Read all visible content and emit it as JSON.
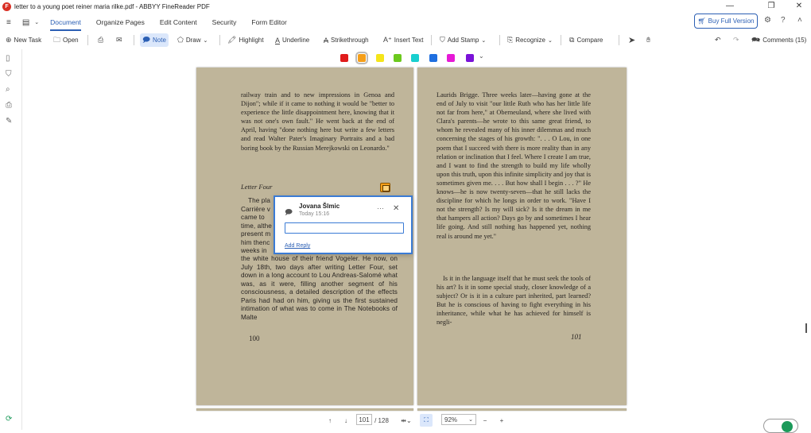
{
  "window": {
    "title": "letter to a young poet reiner maria rilke.pdf - ABBYY FineReader PDF"
  },
  "menu": {
    "tabs": [
      "Document",
      "Organize Pages",
      "Edit Content",
      "Security",
      "Form Editor"
    ],
    "buy_full_version": "Buy Full Version"
  },
  "toolbar": {
    "new_task": "New Task",
    "open": "Open",
    "note": "Note",
    "draw": "Draw",
    "highlight": "Highlight",
    "underline": "Underline",
    "strikethrough": "Strikethrough",
    "insert_text": "Insert Text",
    "add_stamp": "Add Stamp",
    "recognize": "Recognize",
    "compare": "Compare",
    "comments": "Comments (15)"
  },
  "colors": {
    "swatches": [
      "#e01b1b",
      "#f59f1a",
      "#f5e51a",
      "#6cc91e",
      "#19cfcf",
      "#1f6fe0",
      "#e619d6",
      "#7a12d8"
    ],
    "selected_index": 1,
    "accent": "#2b5fb4"
  },
  "left_page": {
    "para1": "railway train and to new impressions in Genoa and Dijon\"; while if it came to nothing it would be \"better to experience the little disappointment here, knowing that it was not one's own fault.\" He went back at the end of April, having \"done nothing here but write a few letters and read Walter Pater's Imaginary Portraits and a bad boring book by the Russian Merejkowski on Leonardo.\"",
    "heading": "Letter Four",
    "para2_lines": [
      "The pla",
      "Carrière v",
      "came to",
      "time, althe",
      "present m",
      "him thenc",
      "weeks in"
    ],
    "para2_rest": "the white house of their friend Vogeler. He now, on July 18th, two days after writing Letter Four, set down in a long account to Lou Andreas-Salomé what was, as it were, filling another segment of his consciousness, a detailed description of the effects Paris had had on him, giving us the first sustained intimation of what was to come in The Notebooks of Malte",
    "page_number": "100"
  },
  "right_page": {
    "text": "Laurids Brigge. Three weeks later—having gone at the end of July to visit \"our little Ruth who has her little life not far from here,\" at Oberneuland, where she lived with Clara's parents—he wrote to this same great friend, to whom he revealed many of his inner dilemmas and much concerning the stages of his growth: \". . . O Lou, in one poem that I succeed with there is more reality than in any relation or inclination that I feel. Where I create I am true, and I want to find the strength to build my life wholly upon this truth, upon this infinite simplicity and joy that is sometimes given me. . . . But how shall I begin . . . ?\" He knows—he is now twenty-seven—that he still lacks the discipline for which he longs in order to work. \"Have I not the strength? Is my will sick? Is it the dream in me that hampers all action? Days go by and sometimes I hear life going. And still nothing has happened yet, nothing real is around me yet.\"",
    "text2": "Is it in the language itself that he must seek the tools of his art? Is it in some special study, closer knowledge of a subject? Or is it in a culture part inherited, part learned? But he is conscious of having to fight everything in his inheritance, while what he has achieved for himself is negli-",
    "page_number": "101"
  },
  "note_popup": {
    "author": "Jovana Šlmic",
    "time": "Today 15:16",
    "more": "···",
    "close": "✕",
    "input_value": "",
    "add_reply": "Add Reply"
  },
  "bottom": {
    "current_page": "101",
    "total_pages": "/ 128",
    "zoom": "92%"
  }
}
